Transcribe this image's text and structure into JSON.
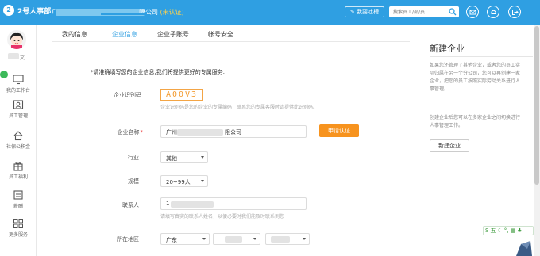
{
  "app": {
    "logo_mark": "2",
    "logo_text": "2号人事部",
    "company_suffix": "限公司",
    "company_tag": "(未认证)"
  },
  "topbar": {
    "feedback_label": "我要吐槽",
    "search_placeholder": "搜索员工/部/员"
  },
  "sidebar": {
    "user_name": "文",
    "items": [
      {
        "label": "我的工作台"
      },
      {
        "label": "员工管理"
      },
      {
        "label": "社保公积金"
      },
      {
        "label": "员工福利"
      },
      {
        "label": "薪酬"
      },
      {
        "label": "更多服务"
      }
    ]
  },
  "tabs": [
    {
      "label": "我的信息"
    },
    {
      "label": "企业信息"
    },
    {
      "label": "企业子账号"
    },
    {
      "label": "帐号安全"
    }
  ],
  "form": {
    "notice": "*请准确填写您的企业信息,我们将提供更好的专属服务.",
    "code_label": "企业识别码",
    "code_value": "A00V3",
    "code_hint": "企业识别码是您的企业的专属编码，联系您的专属客服时请提供此识别码。",
    "name_label": "企业名称",
    "name_required": "*",
    "name_prefix": "广州",
    "name_suffix": "限公司",
    "apply_label": "申请认证",
    "industry_label": "行业",
    "industry_value": "其他",
    "size_label": "规模",
    "size_value": "20~99人",
    "contact_label": "联系人",
    "contact_value": "1",
    "contact_hint": "请填写真实的联系人姓名，以便必要时我们能及时联系到您",
    "region_label": "所在地区",
    "region_province": "广东"
  },
  "right_panel": {
    "title": "新建企业",
    "text1": "如果您还管理了其他企业，或者您的员工实际归属在另一个分公司，您可以再创建一家企业，把您的员工按照实际劳动关系进行人事管理。",
    "text2": "创建企业后您可以在多家企业之间切换进行人事管理工作。",
    "button_label": "新建企业"
  },
  "ime": {
    "label": "五"
  },
  "colors": {
    "brand": "#2f9fe2",
    "accent": "#f7931e",
    "code": "#f39a2e"
  }
}
